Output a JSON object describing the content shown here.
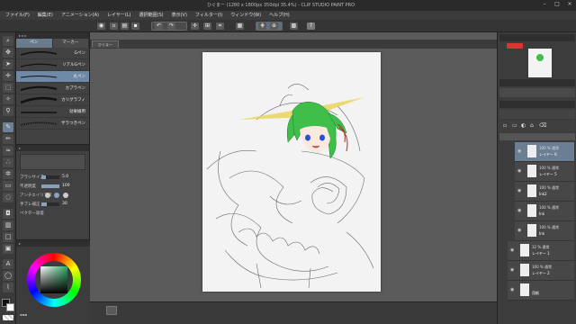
{
  "window": {
    "title": "ひぐまー (1280 x 1800px 350dpi 35.4%) - CLIP STUDIO PAINT PRO"
  },
  "menu": [
    "ファイル(F)",
    "編集(E)",
    "アニメーション(A)",
    "レイヤー(L)",
    "選択範囲(S)",
    "表示(V)",
    "フィルター(I)",
    "ウィンドウ(W)",
    "ヘルプ(H)"
  ],
  "subtool": {
    "tabs": [
      "ペン",
      "マーカー"
    ],
    "brushes": [
      {
        "label": "Gペン",
        "selected": false
      },
      {
        "label": "リアルGペン",
        "selected": false
      },
      {
        "label": "丸ペン",
        "selected": true
      },
      {
        "label": "カブラペン",
        "selected": false
      },
      {
        "label": "カリグラフィ",
        "selected": false
      },
      {
        "label": "効果線用",
        "selected": false
      },
      {
        "label": "ザラつきペン",
        "selected": false
      }
    ]
  },
  "toolprop": {
    "rows": [
      {
        "label": "ブラシサイズ",
        "value": "5.0",
        "fill": 0.25
      },
      {
        "label": "不透明度",
        "value": "100",
        "fill": 1.0
      },
      {
        "label": "アンチエイリアス",
        "value": "",
        "fill": 0
      },
      {
        "label": "手ブレ補正",
        "value": "30",
        "fill": 0.3
      },
      {
        "label": "ベクター吸着",
        "value": "",
        "fill": 0
      }
    ]
  },
  "canvas": {
    "tab": "ひぐまー"
  },
  "layers": [
    {
      "line1": "100 % 通常",
      "line2": "レイヤー 6",
      "selected": true
    },
    {
      "line1": "100 % 通常",
      "line2": "レイヤー 5",
      "selected": false
    },
    {
      "line1": "100 % 通常",
      "line2": "Ink2",
      "selected": false
    },
    {
      "line1": "100 % 通常",
      "line2": "Ink",
      "selected": false
    },
    {
      "line1": "100 % 通常",
      "line2": "Ink",
      "selected": false
    },
    {
      "line1": "32 % 通常",
      "line2": "レイヤー 1",
      "selected": false
    },
    {
      "line1": "100 % 通常",
      "line2": "レイヤー 2",
      "selected": false
    },
    {
      "line1": "",
      "line2": "用紙",
      "selected": false
    }
  ],
  "colors": {
    "accent": "#6f8aa6",
    "hair": "#3fbf4a",
    "eyes": "#2b4fd6",
    "halo": "#e8d24a"
  }
}
